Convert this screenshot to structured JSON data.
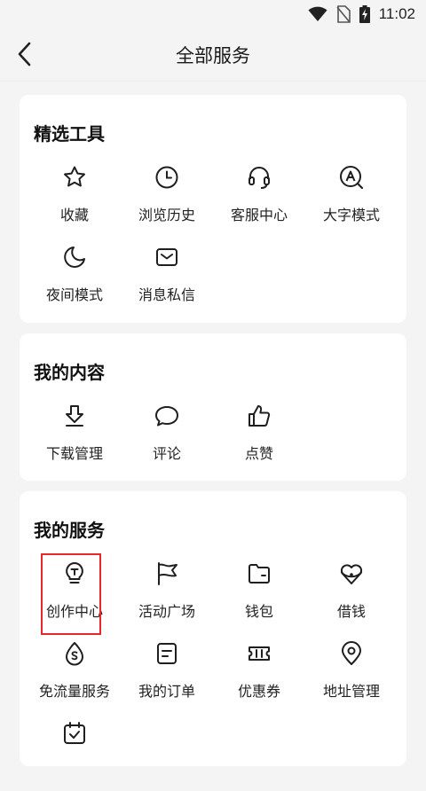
{
  "status": {
    "time": "11:02"
  },
  "header": {
    "title": "全部服务"
  },
  "sections": [
    {
      "title": "精选工具",
      "items": [
        {
          "label": "收藏",
          "icon": "star-icon"
        },
        {
          "label": "浏览历史",
          "icon": "clock-icon"
        },
        {
          "label": "客服中心",
          "icon": "headset-icon"
        },
        {
          "label": "大字模式",
          "icon": "large-font-icon"
        },
        {
          "label": "夜间模式",
          "icon": "moon-icon"
        },
        {
          "label": "消息私信",
          "icon": "envelope-icon"
        }
      ]
    },
    {
      "title": "我的内容",
      "items": [
        {
          "label": "下载管理",
          "icon": "download-icon"
        },
        {
          "label": "评论",
          "icon": "comment-bubble-icon"
        },
        {
          "label": "点赞",
          "icon": "thumbs-up-icon"
        }
      ]
    },
    {
      "title": "我的服务",
      "items": [
        {
          "label": "创作中心",
          "icon": "lightbulb-icon"
        },
        {
          "label": "活动广场",
          "icon": "flag-icon"
        },
        {
          "label": "钱包",
          "icon": "wallet-icon"
        },
        {
          "label": "借钱",
          "icon": "loan-icon"
        },
        {
          "label": "免流量服务",
          "icon": "data-drop-icon"
        },
        {
          "label": "我的订单",
          "icon": "order-list-icon"
        },
        {
          "label": "优惠券",
          "icon": "coupon-icon"
        },
        {
          "label": "地址管理",
          "icon": "location-pin-icon"
        },
        {
          "label": "",
          "icon": "calendar-check-icon"
        }
      ]
    }
  ],
  "colors": {
    "background": "#f4f4f4",
    "card": "#ffffff",
    "highlight": "#e8262b",
    "icon": "#1f1f1f"
  }
}
